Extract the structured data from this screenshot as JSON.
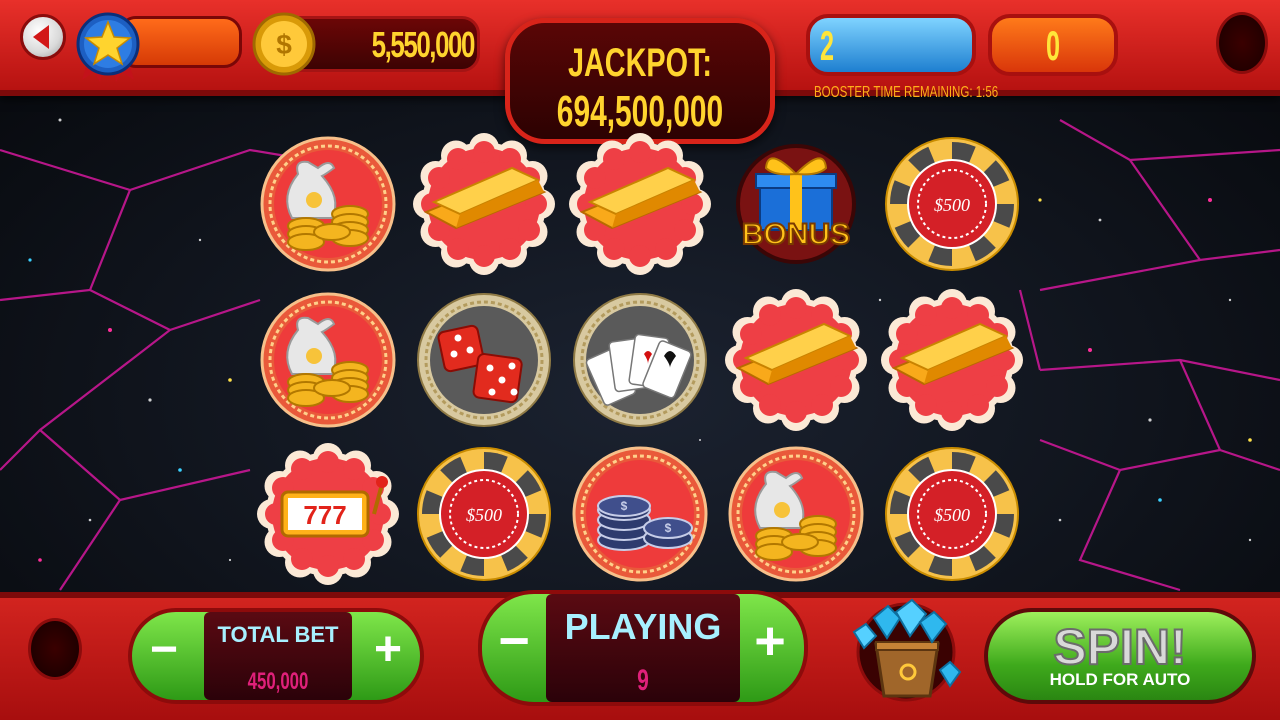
{
  "top_bar": {
    "coins": "5,550,000",
    "jackpot_label": "JACKPOT:",
    "jackpot_value": "694,500,000",
    "booster_count": "2",
    "booster_time": "BOOSTER TIME REMAINING: 1:56",
    "score": "0"
  },
  "reels": [
    [
      "money-bag",
      "gold-bar",
      "gold-bar",
      "bonus-gift",
      "chip-500"
    ],
    [
      "money-bag",
      "dice",
      "cards",
      "gold-bar",
      "gold-bar"
    ],
    [
      "slot-777",
      "chip-500",
      "chip-stacks",
      "money-bag",
      "chip-500"
    ]
  ],
  "symbols": {
    "bonus_text": "BONUS",
    "chip_text": "$500",
    "slot_text": "777"
  },
  "bottom_bar": {
    "total_bet_label": "TOTAL BET",
    "total_bet_value": "450,000",
    "playing_label": "PLAYING",
    "playing_value": "9",
    "minus": "−",
    "plus": "+",
    "spin_label": "SPIN!",
    "spin_sub": "HOLD FOR AUTO"
  },
  "colors": {
    "accent_red": "#c8161a",
    "gold": "#ffd42e",
    "green": "#4cc228"
  }
}
